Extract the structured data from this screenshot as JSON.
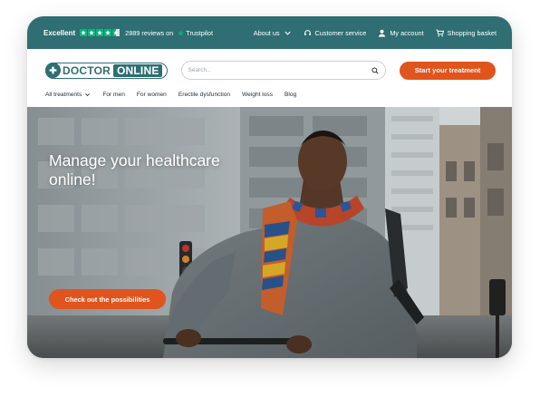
{
  "trustpilot": {
    "rating_label": "Excellent",
    "stars": 4.5,
    "reviews_text": "2889 reviews on",
    "brand": "Trustpilot",
    "star_color": "#00b67a"
  },
  "top_nav": {
    "about": "About us",
    "customer_service": "Customer service",
    "account": "My account",
    "basket": "Shopping basket"
  },
  "header": {
    "logo_word1": "DOCTOR",
    "logo_word2": "ONLINE",
    "search_placeholder": "Search...",
    "cta_label": "Start your treatment"
  },
  "categories": [
    "All treatments",
    "For men",
    "For women",
    "Erectile dysfunction",
    "Weight loss",
    "Blog"
  ],
  "hero": {
    "title": "Manage your healthcare online!",
    "button_label": "Check out the possibilities"
  },
  "colors": {
    "brand_teal": "#2f6e73",
    "accent_orange": "#e0541d"
  }
}
